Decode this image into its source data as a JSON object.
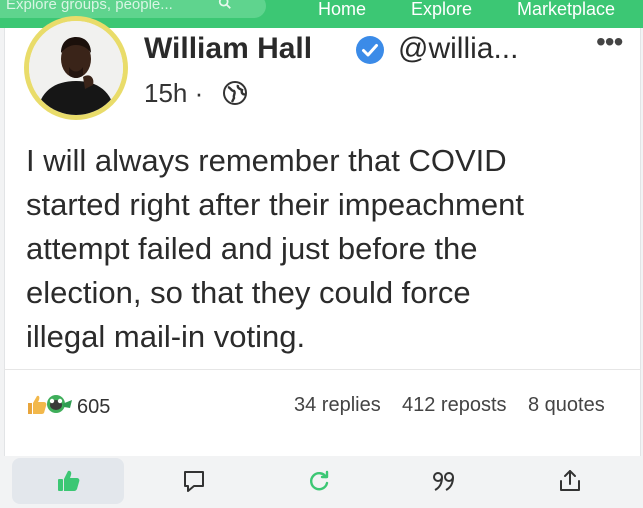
{
  "topbar": {
    "search_placeholder": "Explore groups, people...",
    "nav": [
      "Home",
      "Explore",
      "Marketplace"
    ]
  },
  "post": {
    "author": "William Hall",
    "handle": "@willia...",
    "time": "15h ·",
    "lines": [
      "I will always remember that COVID",
      "started right after their impeachment",
      "attempt failed and just before the",
      "election, so that they could force",
      "illegal mail-in voting."
    ]
  },
  "stats": {
    "reactions": "605",
    "replies": "34 replies",
    "reposts": "412 reposts",
    "quotes": "8 quotes"
  },
  "colors": {
    "brand": "#3cc774",
    "verified": "#3b8be8",
    "avatar_ring": "#e9dc6a"
  },
  "icons": [
    "search-icon",
    "verified-icon",
    "globe-icon",
    "like-icon",
    "comment-icon",
    "repost-icon",
    "quote-icon",
    "share-icon",
    "more-icon"
  ]
}
